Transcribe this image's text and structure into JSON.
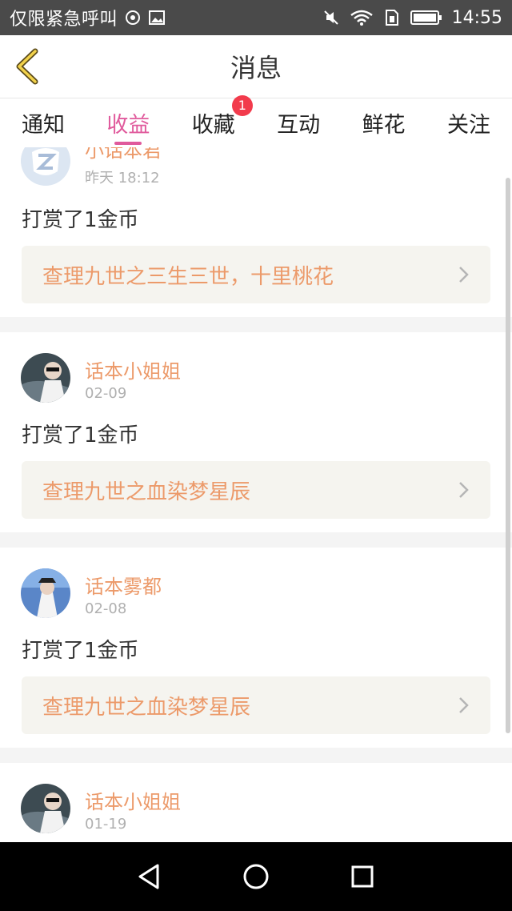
{
  "status_bar": {
    "carrier": "仅限紧急呼叫",
    "time": "14:55",
    "icons": [
      "signal-icon",
      "image-icon",
      "mute-icon",
      "wifi-icon",
      "sim-icon",
      "battery-icon"
    ]
  },
  "header": {
    "title": "消息",
    "back_icon": "back-chevron-icon"
  },
  "tabs": [
    {
      "label": "通知"
    },
    {
      "label": "收益",
      "active": true
    },
    {
      "label": "收藏",
      "badge": "1"
    },
    {
      "label": "互动"
    },
    {
      "label": "鲜花"
    },
    {
      "label": "关注"
    }
  ],
  "messages": [
    {
      "user": "小话本君",
      "date": "昨天 18:12",
      "action": "打赏了1金币",
      "book": "查理九世之三生三世，十里桃花"
    },
    {
      "user": "话本小姐姐",
      "date": "02-09",
      "action": "打赏了1金币",
      "book": "查理九世之血染梦星辰"
    },
    {
      "user": "话本雾都",
      "date": "02-08",
      "action": "打赏了1金币",
      "book": "查理九世之血染梦星辰"
    },
    {
      "user": "话本小姐姐",
      "date": "01-19",
      "action": "",
      "book": ""
    }
  ],
  "colors": {
    "accent_pink": "#e05a9c",
    "orange_text": "#ec9a6a",
    "badge_red": "#f23b4c"
  }
}
